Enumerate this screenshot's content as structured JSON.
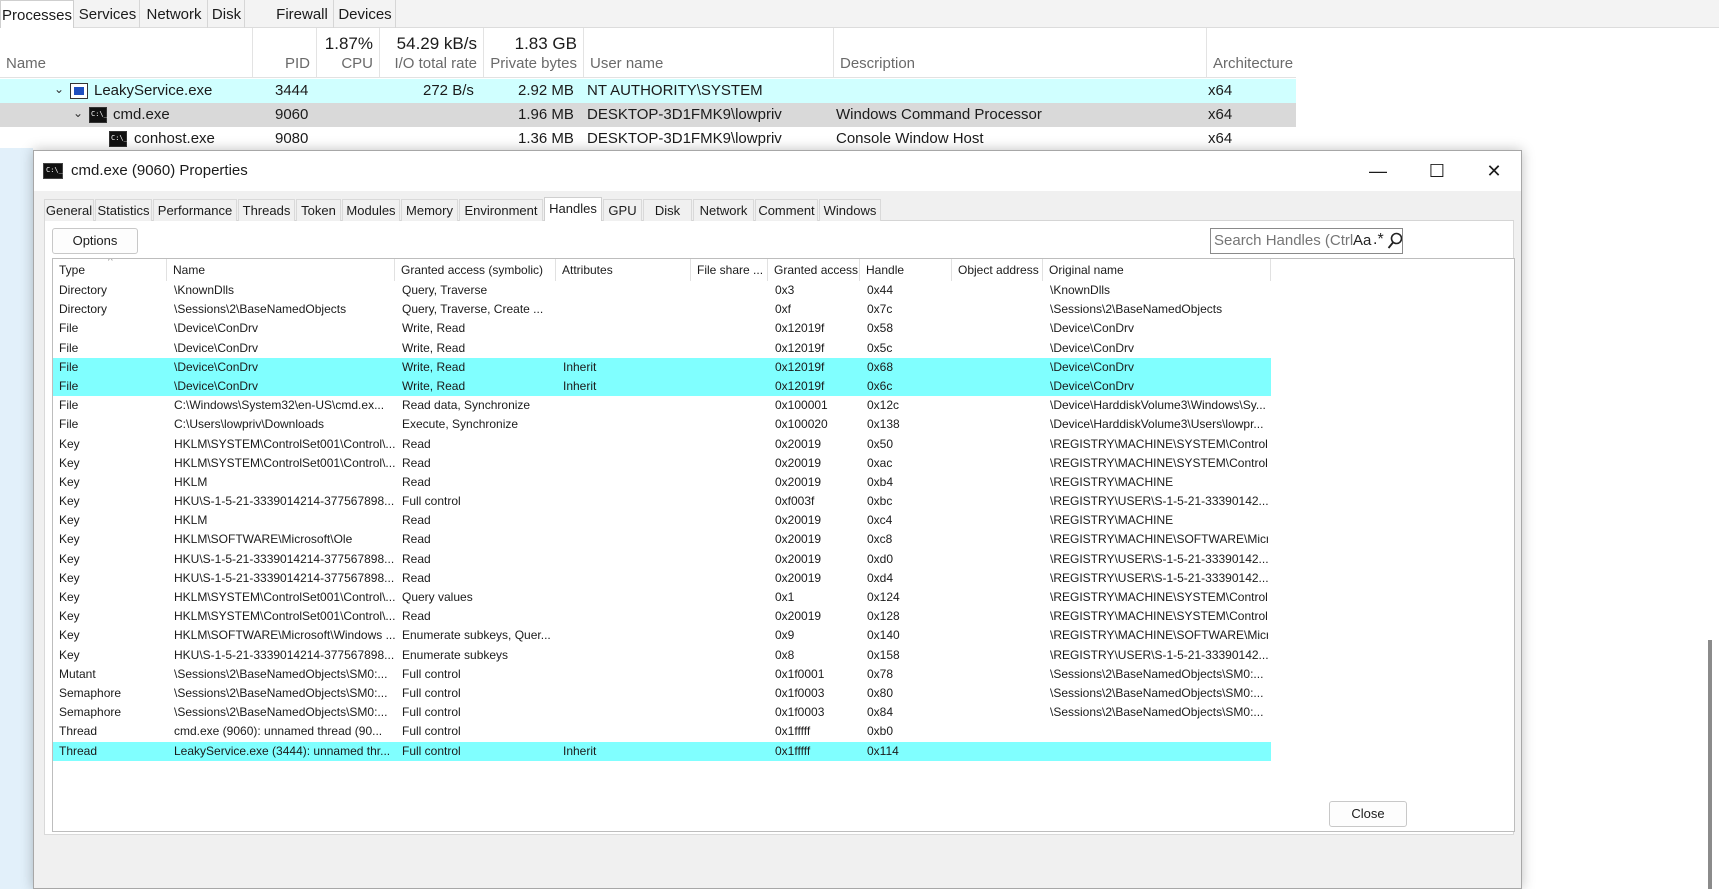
{
  "main_window": {
    "tabs": [
      "Processes",
      "Services",
      "Network",
      "Disk",
      "Firewall",
      "Devices"
    ],
    "active_tab": "Processes",
    "columns": {
      "name": "Name",
      "pid": "PID",
      "cpu_total": "1.87%",
      "cpu": "CPU",
      "io_total": "54.29 kB/s",
      "io": "I/O total rate",
      "private_total": "1.83 GB",
      "private": "Private bytes",
      "user": "User name",
      "description": "Description",
      "architecture": "Architecture"
    },
    "processes": [
      {
        "name": "LeakyService.exe",
        "pid": "3444",
        "io": "272 B/s",
        "private": "2.92 MB",
        "user": "NT AUTHORITY\\SYSTEM",
        "description": "",
        "arch": "x64"
      },
      {
        "name": "cmd.exe",
        "pid": "9060",
        "io": "",
        "private": "1.96 MB",
        "user": "DESKTOP-3D1FMK9\\lowpriv",
        "description": "Windows Command Processor",
        "arch": "x64"
      },
      {
        "name": "conhost.exe",
        "pid": "9080",
        "io": "",
        "private": "1.36 MB",
        "user": "DESKTOP-3D1FMK9\\lowpriv",
        "description": "Console Window Host",
        "arch": "x64"
      }
    ]
  },
  "dialog": {
    "title": "cmd.exe (9060) Properties",
    "controls": {
      "minimize": "—",
      "maximize": "☐",
      "close": "✕"
    },
    "tabs": [
      "General",
      "Statistics",
      "Performance",
      "Threads",
      "Token",
      "Modules",
      "Memory",
      "Environment",
      "Handles",
      "GPU",
      "Disk",
      "Network",
      "Comment",
      "Windows"
    ],
    "active_tab": "Handles",
    "options_label": "Options",
    "search_placeholder": "Search Handles (Ctrl+K)",
    "search_case_label": "Aa",
    "search_regex_label": ".*",
    "close_label": "Close",
    "columns": [
      "Type",
      "Name",
      "Granted access (symbolic)",
      "Attributes",
      "File share ...",
      "Granted access",
      "Handle",
      "Object address",
      "Original name"
    ],
    "sort_indicator": "^",
    "rows": [
      {
        "type": "Directory",
        "name": "\\KnownDlls",
        "symbolic": "Query, Traverse",
        "attributes": "",
        "share": "",
        "access": "0x3",
        "handle": "0x44",
        "address": "",
        "original": "\\KnownDlls",
        "highlight": false
      },
      {
        "type": "Directory",
        "name": "\\Sessions\\2\\BaseNamedObjects",
        "symbolic": "Query, Traverse, Create ...",
        "attributes": "",
        "share": "",
        "access": "0xf",
        "handle": "0x7c",
        "address": "",
        "original": "\\Sessions\\2\\BaseNamedObjects",
        "highlight": false
      },
      {
        "type": "File",
        "name": "\\Device\\ConDrv",
        "symbolic": "Write, Read",
        "attributes": "",
        "share": "",
        "access": "0x12019f",
        "handle": "0x58",
        "address": "",
        "original": "\\Device\\ConDrv",
        "highlight": false
      },
      {
        "type": "File",
        "name": "\\Device\\ConDrv",
        "symbolic": "Write, Read",
        "attributes": "",
        "share": "",
        "access": "0x12019f",
        "handle": "0x5c",
        "address": "",
        "original": "\\Device\\ConDrv",
        "highlight": false
      },
      {
        "type": "File",
        "name": "\\Device\\ConDrv",
        "symbolic": "Write, Read",
        "attributes": "Inherit",
        "share": "",
        "access": "0x12019f",
        "handle": "0x68",
        "address": "",
        "original": "\\Device\\ConDrv",
        "highlight": true
      },
      {
        "type": "File",
        "name": "\\Device\\ConDrv",
        "symbolic": "Write, Read",
        "attributes": "Inherit",
        "share": "",
        "access": "0x12019f",
        "handle": "0x6c",
        "address": "",
        "original": "\\Device\\ConDrv",
        "highlight": true
      },
      {
        "type": "File",
        "name": "C:\\Windows\\System32\\en-US\\cmd.ex...",
        "symbolic": "Read data, Synchronize",
        "attributes": "",
        "share": "",
        "access": "0x100001",
        "handle": "0x12c",
        "address": "",
        "original": "\\Device\\HarddiskVolume3\\Windows\\Sy...",
        "highlight": false
      },
      {
        "type": "File",
        "name": "C:\\Users\\lowpriv\\Downloads",
        "symbolic": "Execute, Synchronize",
        "attributes": "",
        "share": "",
        "access": "0x100020",
        "handle": "0x138",
        "address": "",
        "original": "\\Device\\HarddiskVolume3\\Users\\lowpr...",
        "highlight": false
      },
      {
        "type": "Key",
        "name": "HKLM\\SYSTEM\\ControlSet001\\Control\\...",
        "symbolic": "Read",
        "attributes": "",
        "share": "",
        "access": "0x20019",
        "handle": "0x50",
        "address": "",
        "original": "\\REGISTRY\\MACHINE\\SYSTEM\\Control...",
        "highlight": false
      },
      {
        "type": "Key",
        "name": "HKLM\\SYSTEM\\ControlSet001\\Control\\...",
        "symbolic": "Read",
        "attributes": "",
        "share": "",
        "access": "0x20019",
        "handle": "0xac",
        "address": "",
        "original": "\\REGISTRY\\MACHINE\\SYSTEM\\Control...",
        "highlight": false
      },
      {
        "type": "Key",
        "name": "HKLM",
        "symbolic": "Read",
        "attributes": "",
        "share": "",
        "access": "0x20019",
        "handle": "0xb4",
        "address": "",
        "original": "\\REGISTRY\\MACHINE",
        "highlight": false
      },
      {
        "type": "Key",
        "name": "HKU\\S-1-5-21-3339014214-377567898...",
        "symbolic": "Full control",
        "attributes": "",
        "share": "",
        "access": "0xf003f",
        "handle": "0xbc",
        "address": "",
        "original": "\\REGISTRY\\USER\\S-1-5-21-33390142...",
        "highlight": false
      },
      {
        "type": "Key",
        "name": "HKLM",
        "symbolic": "Read",
        "attributes": "",
        "share": "",
        "access": "0x20019",
        "handle": "0xc4",
        "address": "",
        "original": "\\REGISTRY\\MACHINE",
        "highlight": false
      },
      {
        "type": "Key",
        "name": "HKLM\\SOFTWARE\\Microsoft\\Ole",
        "symbolic": "Read",
        "attributes": "",
        "share": "",
        "access": "0x20019",
        "handle": "0xc8",
        "address": "",
        "original": "\\REGISTRY\\MACHINE\\SOFTWARE\\Micr...",
        "highlight": false
      },
      {
        "type": "Key",
        "name": "HKU\\S-1-5-21-3339014214-377567898...",
        "symbolic": "Read",
        "attributes": "",
        "share": "",
        "access": "0x20019",
        "handle": "0xd0",
        "address": "",
        "original": "\\REGISTRY\\USER\\S-1-5-21-33390142...",
        "highlight": false
      },
      {
        "type": "Key",
        "name": "HKU\\S-1-5-21-3339014214-377567898...",
        "symbolic": "Read",
        "attributes": "",
        "share": "",
        "access": "0x20019",
        "handle": "0xd4",
        "address": "",
        "original": "\\REGISTRY\\USER\\S-1-5-21-33390142...",
        "highlight": false
      },
      {
        "type": "Key",
        "name": "HKLM\\SYSTEM\\ControlSet001\\Control\\...",
        "symbolic": "Query values",
        "attributes": "",
        "share": "",
        "access": "0x1",
        "handle": "0x124",
        "address": "",
        "original": "\\REGISTRY\\MACHINE\\SYSTEM\\Control...",
        "highlight": false
      },
      {
        "type": "Key",
        "name": "HKLM\\SYSTEM\\ControlSet001\\Control\\...",
        "symbolic": "Read",
        "attributes": "",
        "share": "",
        "access": "0x20019",
        "handle": "0x128",
        "address": "",
        "original": "\\REGISTRY\\MACHINE\\SYSTEM\\Control...",
        "highlight": false
      },
      {
        "type": "Key",
        "name": "HKLM\\SOFTWARE\\Microsoft\\Windows ...",
        "symbolic": "Enumerate subkeys, Quer...",
        "attributes": "",
        "share": "",
        "access": "0x9",
        "handle": "0x140",
        "address": "",
        "original": "\\REGISTRY\\MACHINE\\SOFTWARE\\Micr...",
        "highlight": false
      },
      {
        "type": "Key",
        "name": "HKU\\S-1-5-21-3339014214-377567898...",
        "symbolic": "Enumerate subkeys",
        "attributes": "",
        "share": "",
        "access": "0x8",
        "handle": "0x158",
        "address": "",
        "original": "\\REGISTRY\\USER\\S-1-5-21-33390142...",
        "highlight": false
      },
      {
        "type": "Mutant",
        "name": "\\Sessions\\2\\BaseNamedObjects\\SM0:...",
        "symbolic": "Full control",
        "attributes": "",
        "share": "",
        "access": "0x1f0001",
        "handle": "0x78",
        "address": "",
        "original": "\\Sessions\\2\\BaseNamedObjects\\SM0:...",
        "highlight": false
      },
      {
        "type": "Semaphore",
        "name": "\\Sessions\\2\\BaseNamedObjects\\SM0:...",
        "symbolic": "Full control",
        "attributes": "",
        "share": "",
        "access": "0x1f0003",
        "handle": "0x80",
        "address": "",
        "original": "\\Sessions\\2\\BaseNamedObjects\\SM0:...",
        "highlight": false
      },
      {
        "type": "Semaphore",
        "name": "\\Sessions\\2\\BaseNamedObjects\\SM0:...",
        "symbolic": "Full control",
        "attributes": "",
        "share": "",
        "access": "0x1f0003",
        "handle": "0x84",
        "address": "",
        "original": "\\Sessions\\2\\BaseNamedObjects\\SM0:...",
        "highlight": false
      },
      {
        "type": "Thread",
        "name": "cmd.exe (9060): unnamed thread (90...",
        "symbolic": "Full control",
        "attributes": "",
        "share": "",
        "access": "0x1fffff",
        "handle": "0xb0",
        "address": "",
        "original": "",
        "highlight": false
      },
      {
        "type": "Thread",
        "name": "LeakyService.exe (3444): unnamed thr...",
        "symbolic": "Full control",
        "attributes": "Inherit",
        "share": "",
        "access": "0x1fffff",
        "handle": "0x114",
        "address": "",
        "original": "",
        "highlight": true
      }
    ]
  },
  "colors": {
    "highlight_row": "#80ffff",
    "service_row": "#d0ffff",
    "selected_row": "#d9d9d9"
  }
}
